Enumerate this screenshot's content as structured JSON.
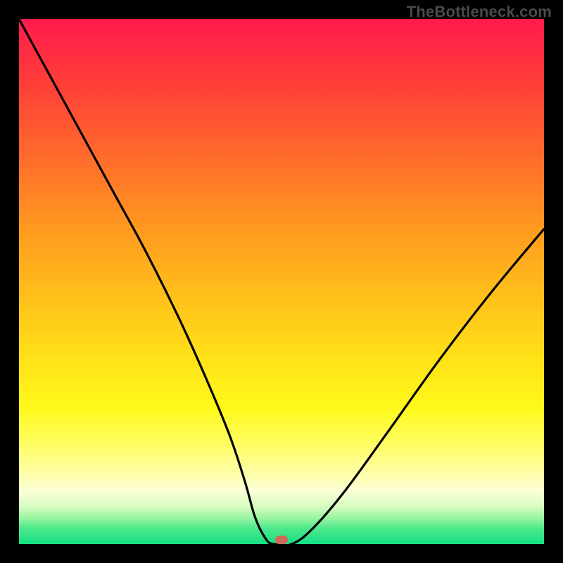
{
  "watermark": "TheBottleneck.com",
  "chart_data": {
    "type": "line",
    "title": "",
    "xlabel": "",
    "ylabel": "",
    "xlim": [
      0,
      100
    ],
    "ylim": [
      0,
      100
    ],
    "grid": false,
    "legend": false,
    "series": [
      {
        "name": "bottleneck-curve",
        "x": [
          0,
          6,
          12,
          18,
          24,
          30,
          35,
          40,
          43,
          45,
          47,
          48.5,
          52,
          56,
          62,
          70,
          80,
          90,
          100
        ],
        "y": [
          100,
          89,
          78,
          67,
          56,
          44,
          33,
          21,
          12,
          5,
          1,
          0,
          0,
          3,
          10,
          21,
          35,
          48,
          60
        ]
      }
    ],
    "annotations": [
      {
        "name": "optimal-marker",
        "x": 50,
        "y": 0.8
      }
    ],
    "gradient_stops": [
      {
        "pct": 0,
        "color": "#ff1a4d"
      },
      {
        "pct": 40,
        "color": "#ff9a1f"
      },
      {
        "pct": 74,
        "color": "#fff81a"
      },
      {
        "pct": 100,
        "color": "#15e086"
      }
    ]
  }
}
